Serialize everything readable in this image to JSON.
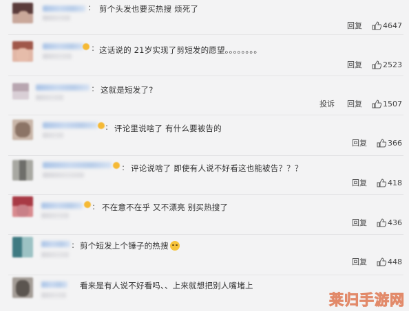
{
  "comments": [
    {
      "text": "剪个头发也要买热搜 烦死了",
      "reply": "回复",
      "likes": "4647",
      "avatar_colors": [
        "#5a3b3a",
        "#c8a79b"
      ],
      "badge": false
    },
    {
      "text": "这话说的 21岁实现了剪短发的愿望。。。。。。。。",
      "reply": "回复",
      "likes": "2523",
      "avatar_colors": [
        "#a0584a",
        "#e2b7a6"
      ],
      "badge": true
    },
    {
      "text": "这就是短发了?",
      "report": "投诉",
      "reply": "回复",
      "likes": "1507",
      "avatar_colors": [
        "#b8a6b0",
        "#d9cfd6"
      ],
      "badge": false
    },
    {
      "text": "评论里说啥了 有什么要被告的",
      "reply": "回复",
      "likes": "366",
      "avatar_colors": [
        "#8c7466",
        "#c9b6a9"
      ],
      "badge": true
    },
    {
      "text": "评论说啥了 即使有人说不好看这也能被告？？？",
      "reply": "回复",
      "likes": "418",
      "avatar_colors": [
        "#6e6e6a",
        "#a8a8a2"
      ],
      "badge": true
    },
    {
      "text": "不在意不在乎 又不漂亮 别买热搜了",
      "reply": "回复",
      "likes": "436",
      "avatar_colors": [
        "#a83a45",
        "#d88a8e"
      ],
      "badge": true
    },
    {
      "text": "剪个短发上个锤子的热搜",
      "reply": "回复",
      "likes": "448",
      "avatar_colors": [
        "#3f7a82",
        "#9cc2c4"
      ],
      "badge": false,
      "emoji": true
    },
    {
      "text": "看来是有人说不好看吗、、上来就想把别人嘴堵上",
      "avatar_colors": [
        "#5b5550",
        "#a39c96"
      ],
      "badge": false
    }
  ],
  "watermark": "莱归手游网",
  "colors": {
    "background": "#f3f3f4",
    "name_blur": "#b8cde9"
  }
}
